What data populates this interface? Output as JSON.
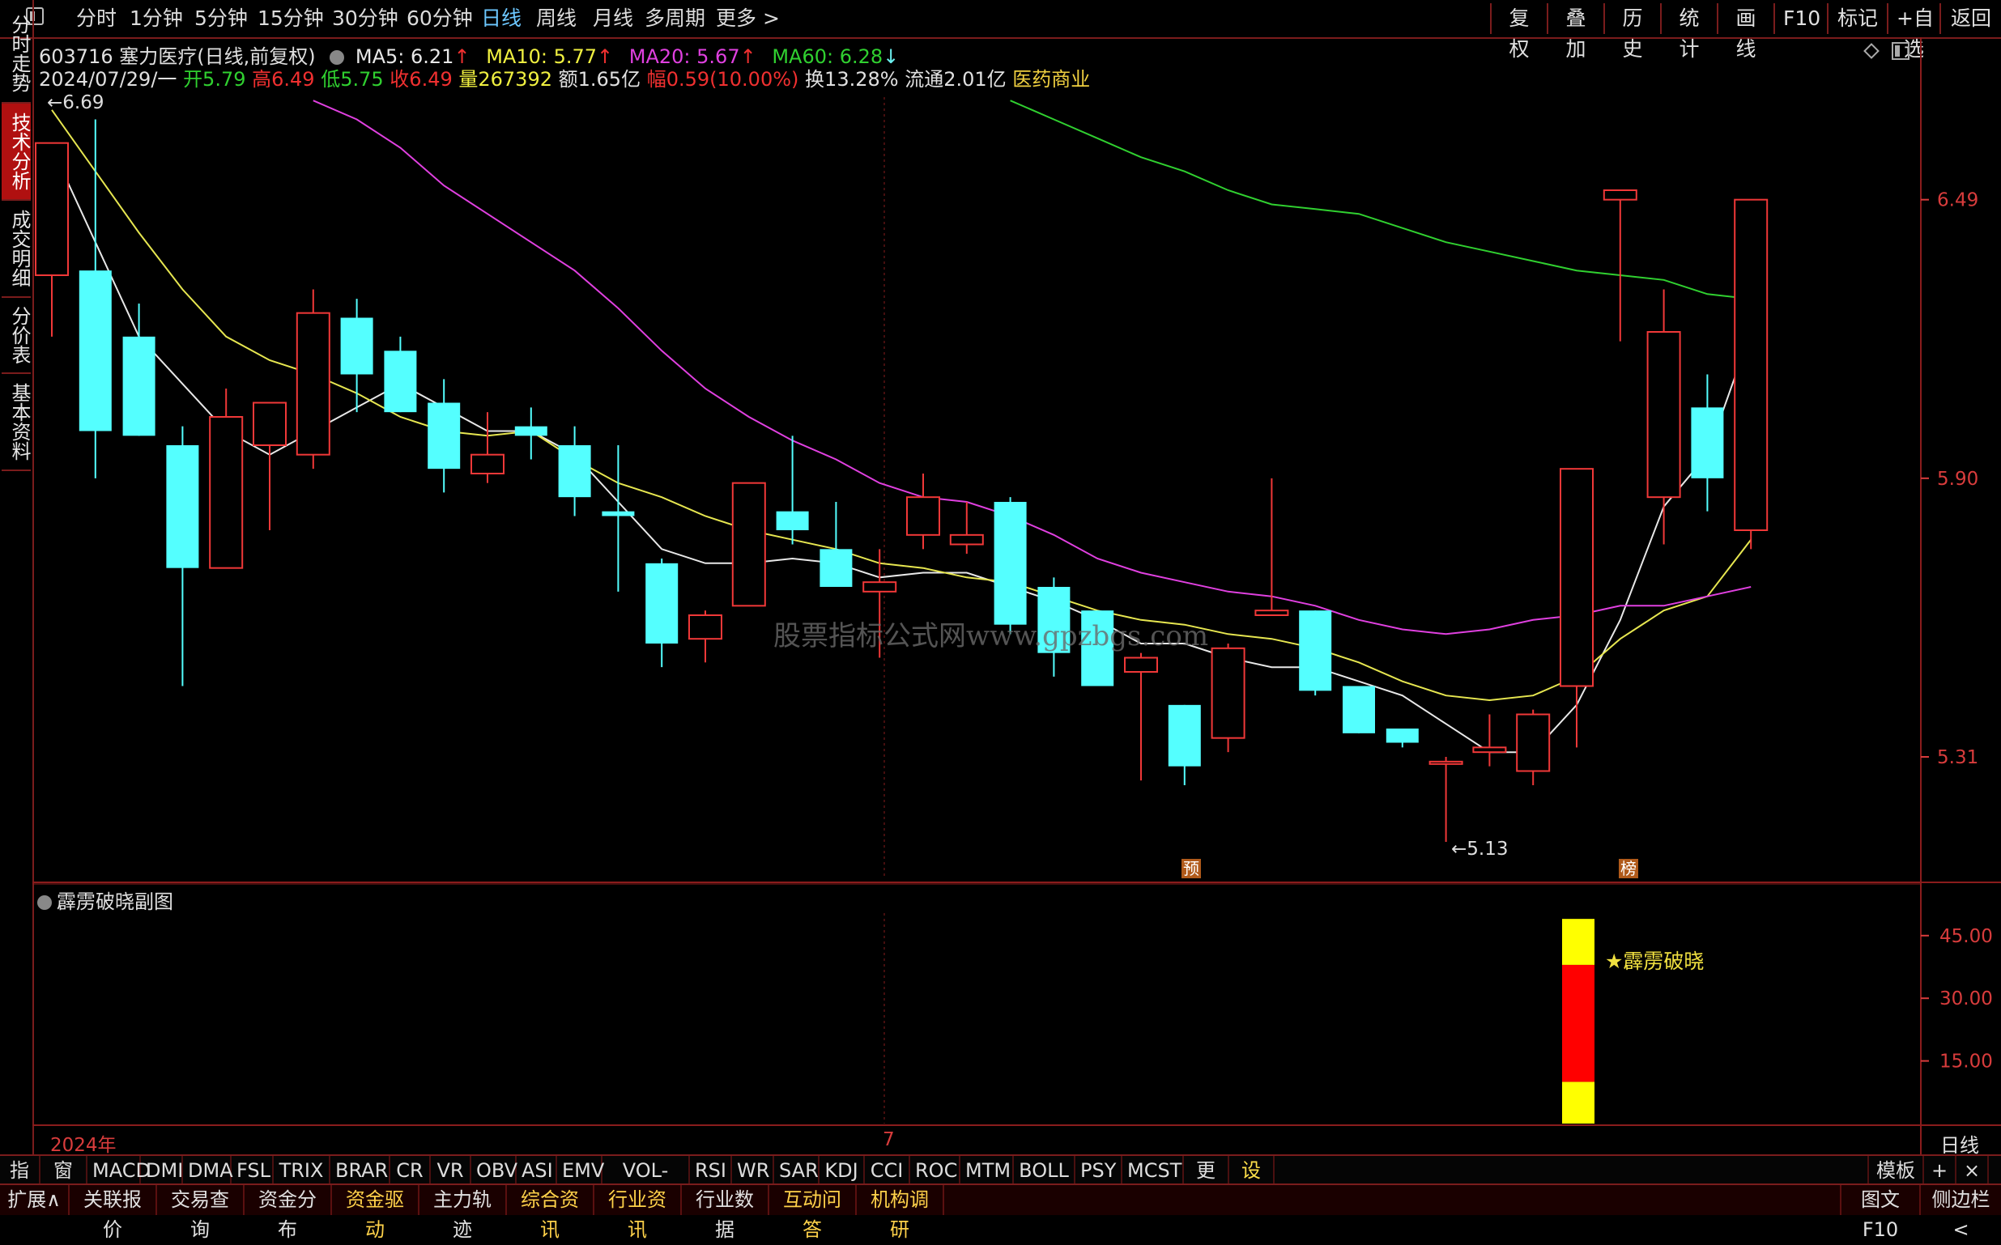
{
  "toolbar": {
    "periods": [
      "分时",
      "1分钟",
      "5分钟",
      "15分钟",
      "30分钟",
      "60分钟",
      "日线",
      "周线",
      "月线",
      "多周期",
      "更多 >"
    ],
    "active_period": "日线",
    "right_buttons": [
      "复权",
      "叠加",
      "历史",
      "统计",
      "画线",
      "F10",
      "标记",
      "+自选",
      "返回"
    ]
  },
  "side_tabs": [
    "分时走势",
    "技术分析",
    "成交明细",
    "分价表",
    "基本资料"
  ],
  "stock": {
    "header": "603716 塞力医疗(日线,前复权)",
    "ma5": "MA5: 6.21",
    "ma10": "MA10: 5.77",
    "ma20": "MA20: 5.67",
    "ma60": "MA60: 6.28"
  },
  "quote": {
    "date": "2024/07/29/一",
    "open": "开5.79",
    "high": "高6.49",
    "low": "低5.75",
    "close": "收6.49",
    "volume": "量267392",
    "amount": "额1.65亿",
    "change": "幅0.59(10.00%)",
    "turnover": "换13.28%",
    "float": "流通2.01亿",
    "industry": "医药商业"
  },
  "main_chart": {
    "high_mark": "6.69",
    "low_mark": "5.13",
    "yticks": [
      "6.49",
      "5.90",
      "5.31"
    ],
    "watermark": "股票指标公式网www.gpzbgs.com",
    "badge_pre": "预",
    "badge_bang": "榜"
  },
  "sub_chart": {
    "title": "霹雳破晓副图",
    "signal_label": "★霹雳破晓",
    "yticks": [
      "45.00",
      "30.00",
      "15.00"
    ]
  },
  "x_axis": {
    "year": "2024年",
    "month": "7",
    "period_label": "日线"
  },
  "indicator_bar": [
    "指标",
    "窗口",
    "MACD",
    "DMI",
    "DMA",
    "FSL",
    "TRIX",
    "BRAR",
    "CR",
    "VR",
    "OBV",
    "ASI",
    "EMV",
    "VOL-TDX",
    "RSI",
    "WR",
    "SAR",
    "KDJ",
    "CCI",
    "ROC",
    "MTM",
    "BOLL",
    "PSY",
    "MCST",
    "更多",
    "设置"
  ],
  "template_label": "模板",
  "ext_bar": [
    "扩展∧",
    "关联报价",
    "交易查询",
    "资金分布",
    "资金驱动",
    "主力轨迹",
    "综合资讯",
    "行业资讯",
    "行业数据",
    "互动问答",
    "机构调研"
  ],
  "ext_right": [
    "图文F10",
    "侧边栏 <"
  ],
  "chart_data": {
    "type": "candlestick",
    "candles": [
      {
        "o": 6.33,
        "h": 6.42,
        "l": 6.2,
        "c": 6.61
      },
      {
        "o": 6.34,
        "h": 6.66,
        "l": 5.9,
        "c": 6.0
      },
      {
        "o": 6.2,
        "h": 6.27,
        "l": 6.0,
        "c": 5.99
      },
      {
        "o": 5.97,
        "h": 6.01,
        "l": 5.46,
        "c": 5.71
      },
      {
        "o": 5.71,
        "h": 6.09,
        "l": 5.71,
        "c": 6.03
      },
      {
        "o": 5.97,
        "h": 6.04,
        "l": 5.79,
        "c": 6.06
      },
      {
        "o": 5.95,
        "h": 6.3,
        "l": 5.92,
        "c": 6.25
      },
      {
        "o": 6.24,
        "h": 6.28,
        "l": 6.04,
        "c": 6.12
      },
      {
        "o": 6.17,
        "h": 6.2,
        "l": 6.04,
        "c": 6.04
      },
      {
        "o": 6.06,
        "h": 6.11,
        "l": 5.87,
        "c": 5.92
      },
      {
        "o": 5.91,
        "h": 6.04,
        "l": 5.89,
        "c": 5.95
      },
      {
        "o": 6.01,
        "h": 6.05,
        "l": 5.94,
        "c": 5.99
      },
      {
        "o": 5.97,
        "h": 6.01,
        "l": 5.82,
        "c": 5.86
      },
      {
        "o": 5.83,
        "h": 5.97,
        "l": 5.66,
        "c": 5.82
      },
      {
        "o": 5.72,
        "h": 5.73,
        "l": 5.5,
        "c": 5.55
      },
      {
        "o": 5.56,
        "h": 5.62,
        "l": 5.51,
        "c": 5.61
      },
      {
        "o": 5.63,
        "h": 5.89,
        "l": 5.63,
        "c": 5.89
      },
      {
        "o": 5.83,
        "h": 5.99,
        "l": 5.76,
        "c": 5.79
      },
      {
        "o": 5.75,
        "h": 5.85,
        "l": 5.73,
        "c": 5.67
      },
      {
        "o": 5.66,
        "h": 5.75,
        "l": 5.52,
        "c": 5.68
      },
      {
        "o": 5.78,
        "h": 5.91,
        "l": 5.75,
        "c": 5.86
      },
      {
        "o": 5.76,
        "h": 5.85,
        "l": 5.74,
        "c": 5.78
      },
      {
        "o": 5.85,
        "h": 5.86,
        "l": 5.57,
        "c": 5.59
      },
      {
        "o": 5.67,
        "h": 5.69,
        "l": 5.48,
        "c": 5.53
      },
      {
        "o": 5.62,
        "h": 5.61,
        "l": 5.46,
        "c": 5.46
      },
      {
        "o": 5.49,
        "h": 5.53,
        "l": 5.26,
        "c": 5.52
      },
      {
        "o": 5.42,
        "h": 5.42,
        "l": 5.25,
        "c": 5.29
      },
      {
        "o": 5.35,
        "h": 5.55,
        "l": 5.32,
        "c": 5.54
      },
      {
        "o": 5.61,
        "h": 5.9,
        "l": 5.64,
        "c": 5.62
      },
      {
        "o": 5.62,
        "h": 5.62,
        "l": 5.44,
        "c": 5.45
      },
      {
        "o": 5.46,
        "h": 5.45,
        "l": 5.38,
        "c": 5.36
      },
      {
        "o": 5.37,
        "h": 5.36,
        "l": 5.33,
        "c": 5.34
      },
      {
        "o": 5.3,
        "h": 5.31,
        "l": 5.13,
        "c": 5.3
      },
      {
        "o": 5.32,
        "h": 5.4,
        "l": 5.29,
        "c": 5.33
      },
      {
        "o": 5.28,
        "h": 5.41,
        "l": 5.25,
        "c": 5.4
      },
      {
        "o": 5.46,
        "h": 5.92,
        "l": 5.33,
        "c": 5.92
      },
      {
        "o": 6.49,
        "h": 6.49,
        "l": 6.19,
        "c": 6.51
      },
      {
        "o": 5.86,
        "h": 6.3,
        "l": 5.76,
        "c": 6.21
      },
      {
        "o": 6.05,
        "h": 6.12,
        "l": 5.83,
        "c": 5.9
      },
      {
        "o": 5.79,
        "h": 6.49,
        "l": 5.75,
        "c": 6.49
      }
    ],
    "ma_series": [
      {
        "name": "MA5",
        "color": "#e8e8e8",
        "values": [
          6.6,
          6.4,
          6.2,
          6.1,
          6.0,
          5.95,
          6.0,
          6.05,
          6.1,
          6.05,
          6.0,
          6.0,
          5.95,
          5.85,
          5.75,
          5.72,
          5.72,
          5.73,
          5.72,
          5.69,
          5.7,
          5.7,
          5.67,
          5.64,
          5.6,
          5.55,
          5.55,
          5.52,
          5.5,
          5.5,
          5.47,
          5.44,
          5.38,
          5.32,
          5.32,
          5.42,
          5.6,
          5.84,
          5.95,
          6.21
        ]
      },
      {
        "name": "MA10",
        "color": "#e6e650",
        "values": [
          6.68,
          6.55,
          6.42,
          6.3,
          6.2,
          6.15,
          6.12,
          6.08,
          6.03,
          6.0,
          5.99,
          6.0,
          5.94,
          5.89,
          5.86,
          5.82,
          5.79,
          5.77,
          5.75,
          5.72,
          5.71,
          5.69,
          5.68,
          5.65,
          5.62,
          5.6,
          5.59,
          5.57,
          5.56,
          5.54,
          5.51,
          5.47,
          5.44,
          5.43,
          5.44,
          5.48,
          5.56,
          5.62,
          5.65,
          5.77
        ]
      },
      {
        "name": "MA20",
        "color": "#e040e0",
        "values": [
          null,
          null,
          null,
          null,
          null,
          null,
          6.7,
          6.66,
          6.6,
          6.52,
          6.46,
          6.4,
          6.34,
          6.26,
          6.17,
          6.09,
          6.03,
          5.98,
          5.94,
          5.89,
          5.86,
          5.85,
          5.82,
          5.78,
          5.73,
          5.7,
          5.68,
          5.66,
          5.65,
          5.63,
          5.6,
          5.58,
          5.57,
          5.58,
          5.6,
          5.61,
          5.63,
          5.63,
          5.65,
          5.67
        ]
      },
      {
        "name": "MA60",
        "color": "#30d030",
        "values": [
          null,
          null,
          null,
          null,
          null,
          null,
          null,
          null,
          null,
          null,
          null,
          null,
          null,
          null,
          null,
          null,
          null,
          null,
          null,
          null,
          null,
          null,
          6.7,
          6.66,
          6.62,
          6.58,
          6.55,
          6.51,
          6.48,
          6.47,
          6.46,
          6.43,
          6.4,
          6.38,
          6.36,
          6.34,
          6.33,
          6.32,
          6.29,
          6.28
        ]
      }
    ],
    "signal": {
      "index": 35,
      "bands": [
        {
          "from": 0,
          "to": 10
        },
        {
          "from": 10,
          "to": 38
        },
        {
          "from": 38,
          "to": 49
        }
      ]
    },
    "ylim_main": [
      5.13,
      6.69
    ],
    "ylim_sub": [
      0,
      50
    ]
  }
}
